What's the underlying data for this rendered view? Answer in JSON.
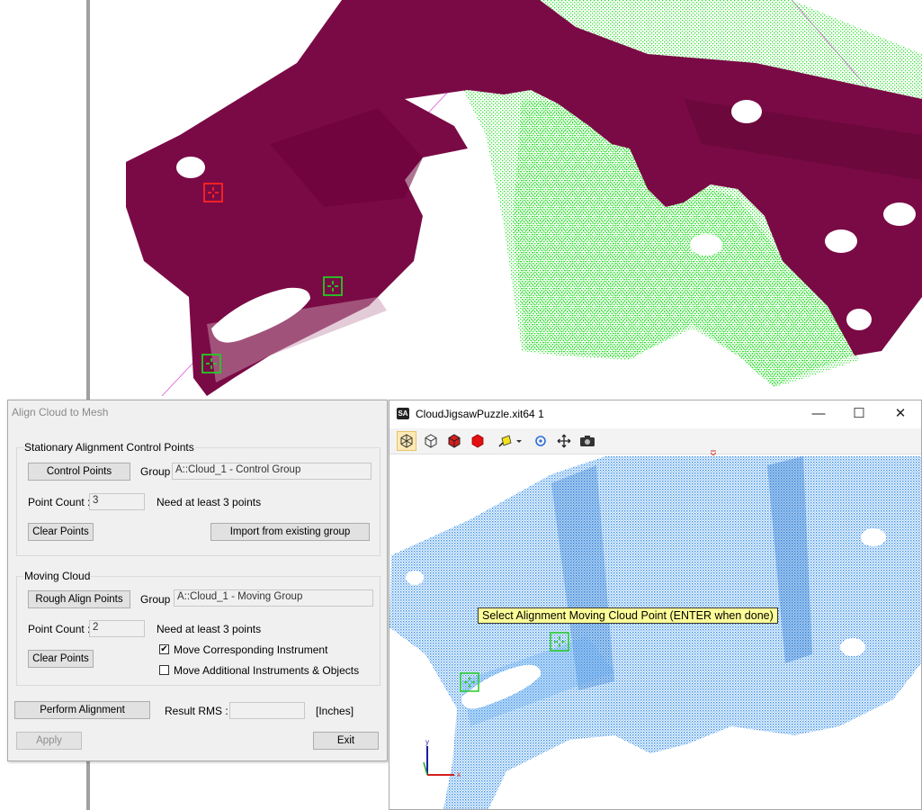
{
  "dialog": {
    "title": "Align Cloud to Mesh",
    "stationary": {
      "section_label": "Stationary Alignment Control Points",
      "control_points_button": "Control Points",
      "group_label": "Group :",
      "group_value": "A::Cloud_1 - Control Group",
      "point_count_label": "Point Count :",
      "point_count_value": "3",
      "hint": "Need at least 3 points",
      "clear_button": "Clear Points",
      "import_button": "Import from existing group"
    },
    "moving": {
      "section_label": "Moving Cloud",
      "rough_align_button": "Rough Align Points",
      "group_label": "Group :",
      "group_value": "A::Cloud_1 - Moving Group",
      "point_count_label": "Point Count :",
      "point_count_value": "2",
      "hint": "Need at least 3 points",
      "clear_button": "Clear Points",
      "move_instrument_label": "Move Corresponding Instrument",
      "move_instrument_checked": true,
      "move_additional_label": "Move Additional Instruments & Objects",
      "move_additional_checked": false
    },
    "perform_button": "Perform Alignment",
    "result_rms_label": "Result RMS :",
    "result_rms_value": "",
    "units": "[Inches]",
    "apply_button": "Apply",
    "exit_button": "Exit"
  },
  "sa_window": {
    "logo": "SA",
    "title": "CloudJigsawPuzzle.xit64 1",
    "controls": {
      "minimize": "—",
      "maximize": "☐",
      "close": "✕"
    },
    "toolbar_icons": [
      "cube-wireframe-icon",
      "cube-outline-icon",
      "cube-red-icon",
      "cube-solid-red-icon",
      "yellow-arrow-icon",
      "rotate-icon",
      "move-icon",
      "camera-icon"
    ],
    "tooltip": "Select Alignment Moving Cloud Point (ENTER when done)",
    "axis_labels": {
      "x": "x",
      "y": "y"
    }
  },
  "colors": {
    "mesh": "#7a0a45",
    "cloud_green": "#33e033",
    "cloud_blue": "#3a8fe0",
    "marker_red": "#ff2222",
    "marker_green": "#22cc22",
    "tooltip_bg": "#ffff99"
  }
}
